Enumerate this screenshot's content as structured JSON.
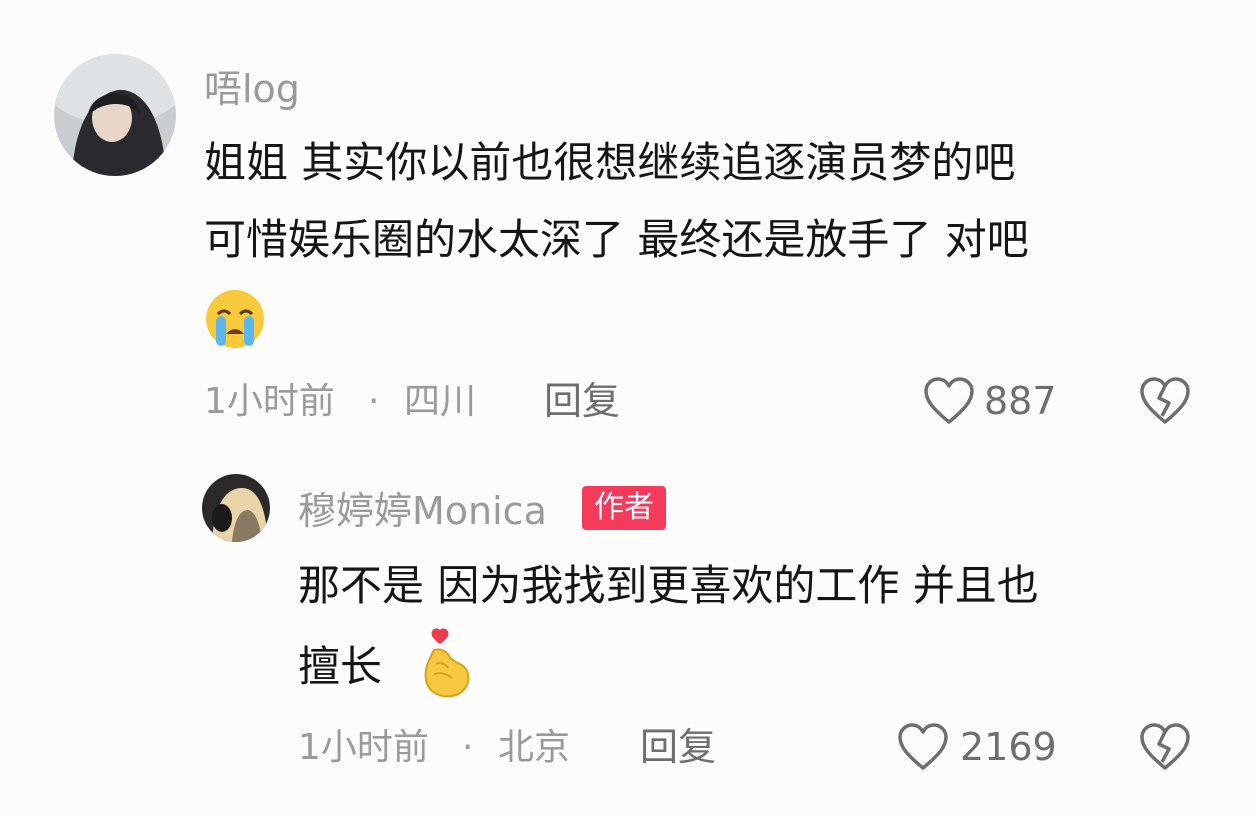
{
  "comments": [
    {
      "username": "唔log",
      "lines": [
        "姐姐 其实你以前也很想继续追逐演员梦的吧",
        "可惜娱乐圈的水太深了 最终还是放手了 对吧"
      ],
      "emoji": "crying-face-emoji",
      "time": "1小时前",
      "location": "四川",
      "separator": "·",
      "reply_label": "回复",
      "likes": "887"
    },
    {
      "username": "穆婷婷Monica",
      "badge": "作者",
      "lines": [
        "那不是 因为我找到更喜欢的工作 并且也",
        "擅长"
      ],
      "emoji": "finger-heart-emoji",
      "time": "1小时前",
      "location": "北京",
      "separator": "·",
      "reply_label": "回复",
      "likes": "2169"
    }
  ],
  "colors": {
    "badge": "#f53a5c",
    "meta_text": "#9a9a9a",
    "content_text": "#151515"
  }
}
